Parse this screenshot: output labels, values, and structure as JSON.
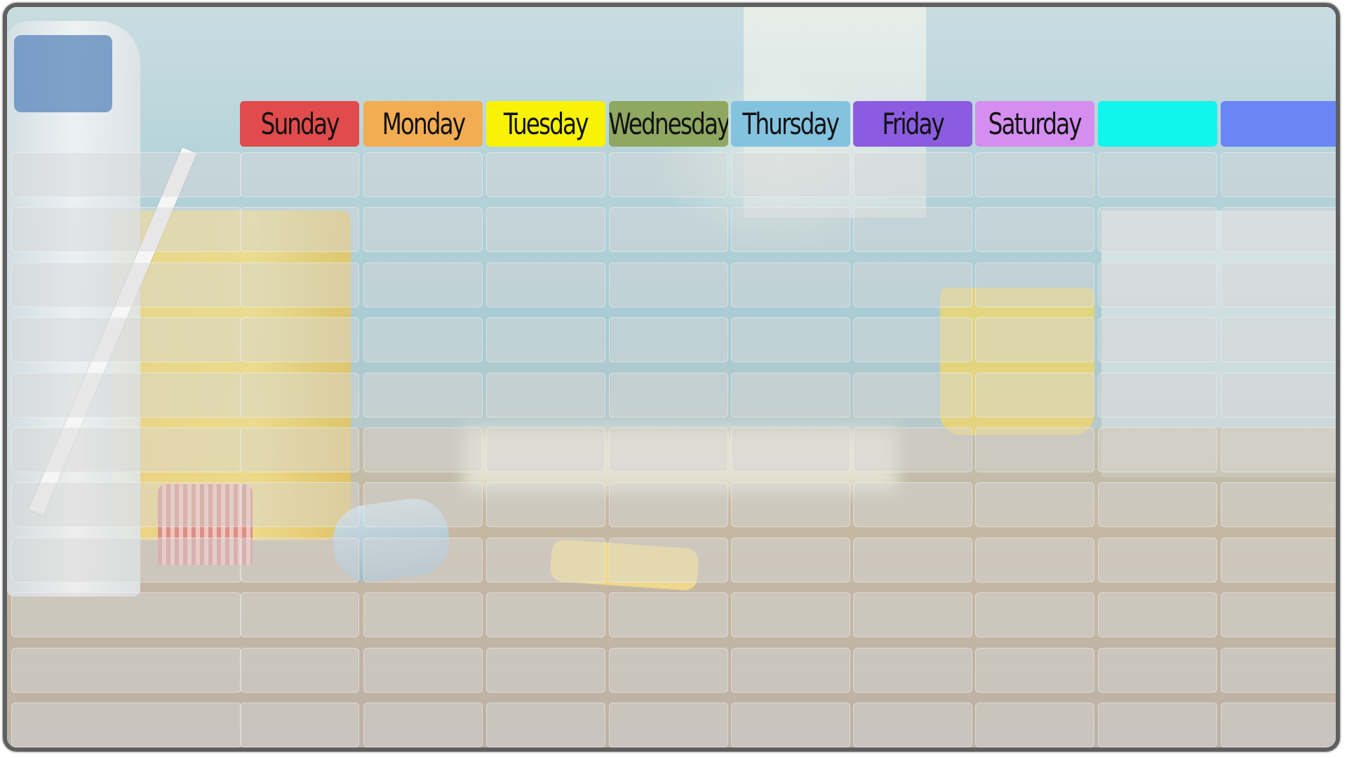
{
  "planner": {
    "days": [
      {
        "label": "Sunday",
        "color": "#e14b4b"
      },
      {
        "label": "Monday",
        "color": "#f2ad52"
      },
      {
        "label": "Tuesday",
        "color": "#f7f206"
      },
      {
        "label": "Wednesday",
        "color": "#8fa861"
      },
      {
        "label": "Thursday",
        "color": "#83c3e0"
      },
      {
        "label": "Friday",
        "color": "#8b5ce0"
      },
      {
        "label": "Saturday",
        "color": "#d48ef0"
      },
      {
        "label": "",
        "color": "#11f5ec"
      },
      {
        "label": "",
        "color": "#6a86f5"
      }
    ],
    "row_count": 11
  }
}
